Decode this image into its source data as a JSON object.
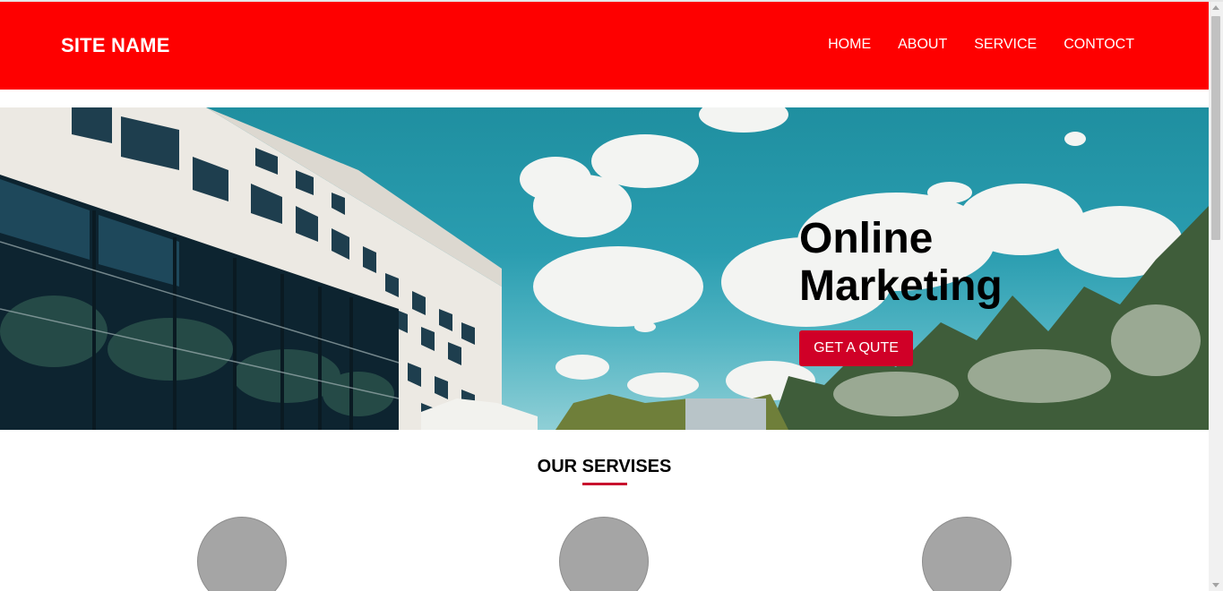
{
  "header": {
    "site_name": "SITE NAME",
    "nav": [
      {
        "label": "HOME"
      },
      {
        "label": "ABOUT"
      },
      {
        "label": "SERVICE"
      },
      {
        "label": "CONTOCT"
      }
    ]
  },
  "hero": {
    "title_line1": "Online",
    "title_line2": "Marketing",
    "cta_label": "GET A QUTE",
    "image": "hotel building and trees under blue sky"
  },
  "services": {
    "title": "OUR SERVISES",
    "items": [
      {
        "icon": "placeholder-circle"
      },
      {
        "icon": "placeholder-circle"
      },
      {
        "icon": "placeholder-circle"
      }
    ]
  },
  "colors": {
    "navbar": "#fe0000",
    "accent": "#d00027",
    "circle": "#a5a5a5"
  }
}
